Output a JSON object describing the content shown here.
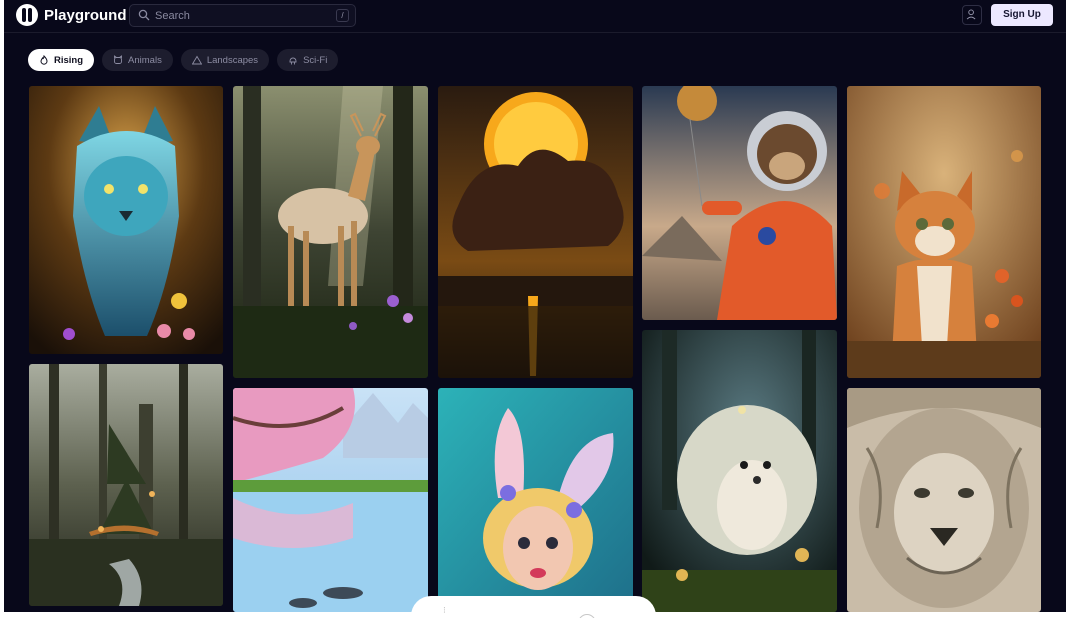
{
  "header": {
    "app_name": "Playground",
    "search_placeholder": "Search",
    "search_shortcut": "/",
    "signup_label": "Sign Up",
    "user_icon": "user-icon"
  },
  "filters": [
    {
      "label": "Rising",
      "icon": "flame-icon",
      "active": true
    },
    {
      "label": "Animals",
      "icon": "animal-face-icon",
      "active": false
    },
    {
      "label": "Landscapes",
      "icon": "mountain-icon",
      "active": false
    },
    {
      "label": "Sci-Fi",
      "icon": "robot-icon",
      "active": false
    }
  ],
  "gallery": [
    "blue-tiger-image",
    "deer-forest-image",
    "sunset-clouds-image",
    "astronaut-monkey-image",
    "autumn-cat-image",
    "misty-forest-image",
    "cherry-blossom-lake-image",
    "bunny-girl-image",
    "hedgehog-image",
    "ornate-lion-image"
  ],
  "colors": {
    "background": "#08081a",
    "signup_bg": "#ece8ff",
    "chip_bg": "#1d1d2e"
  }
}
